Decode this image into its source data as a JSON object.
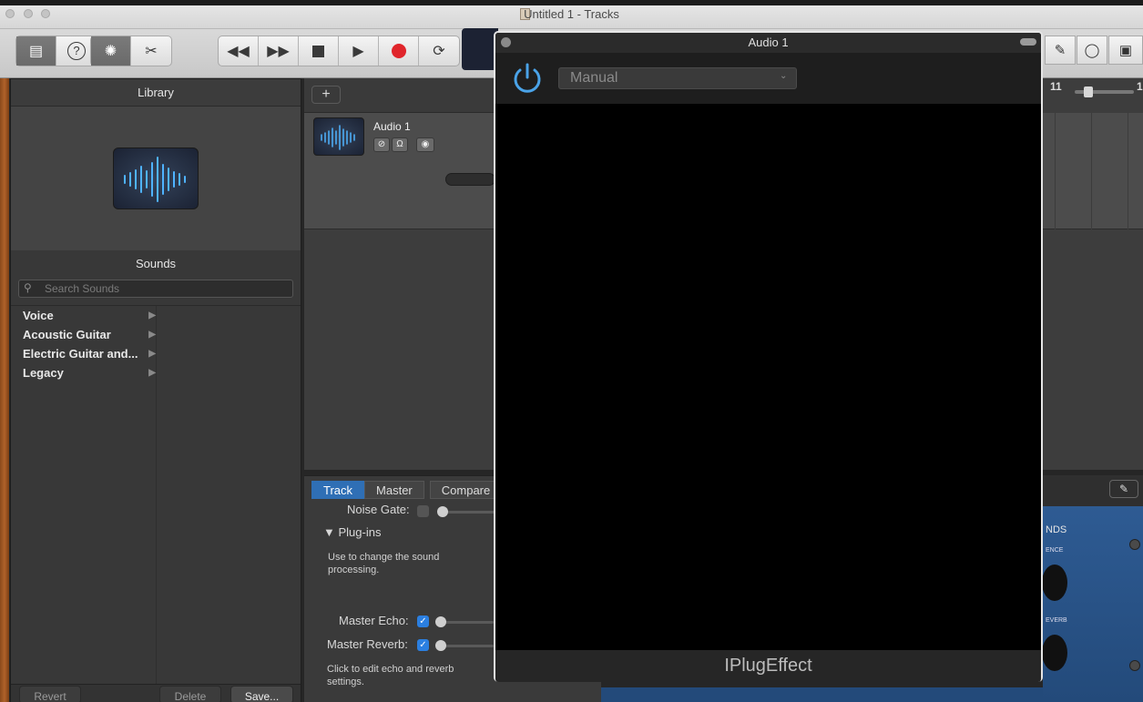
{
  "window": {
    "title": "Untitled 1 - Tracks"
  },
  "toolbar": {
    "library_icon": "library-icon",
    "help_label": "?",
    "transport": [
      "rewind",
      "fast-forward",
      "stop",
      "play",
      "record",
      "cycle"
    ]
  },
  "library": {
    "title": "Library",
    "sounds_title": "Sounds",
    "search_placeholder": "Search Sounds",
    "categories": [
      {
        "label": "Voice"
      },
      {
        "label": "Acoustic Guitar"
      },
      {
        "label": "Electric Guitar and..."
      },
      {
        "label": "Legacy"
      }
    ],
    "footer": {
      "revert": "Revert",
      "delete": "Delete",
      "save": "Save..."
    }
  },
  "tracks": {
    "add_label": "+",
    "track_name": "Audio 1",
    "ruler_bar": "11",
    "ruler_bar2": "1"
  },
  "smart_controls": {
    "tabs": [
      "Track",
      "Master",
      "Compare"
    ],
    "noise_gate_label": "Noise Gate:",
    "plugins_label": "Plug-ins",
    "plugins_desc": "Use to change the sound processing.",
    "master_echo_label": "Master Echo:",
    "master_reverb_label": "Master Reverb:",
    "edit_desc": "Click to edit echo and reverb settings."
  },
  "amp": {
    "label1": "NDS",
    "label2": "ENCE",
    "label3": "EVERB"
  },
  "plugin": {
    "title": "Audio 1",
    "preset": "Manual",
    "footer": "IPlugEffect"
  },
  "colors": {
    "accent": "#2f6fb5",
    "record": "#e0252b",
    "power": "#4aa3e8"
  }
}
